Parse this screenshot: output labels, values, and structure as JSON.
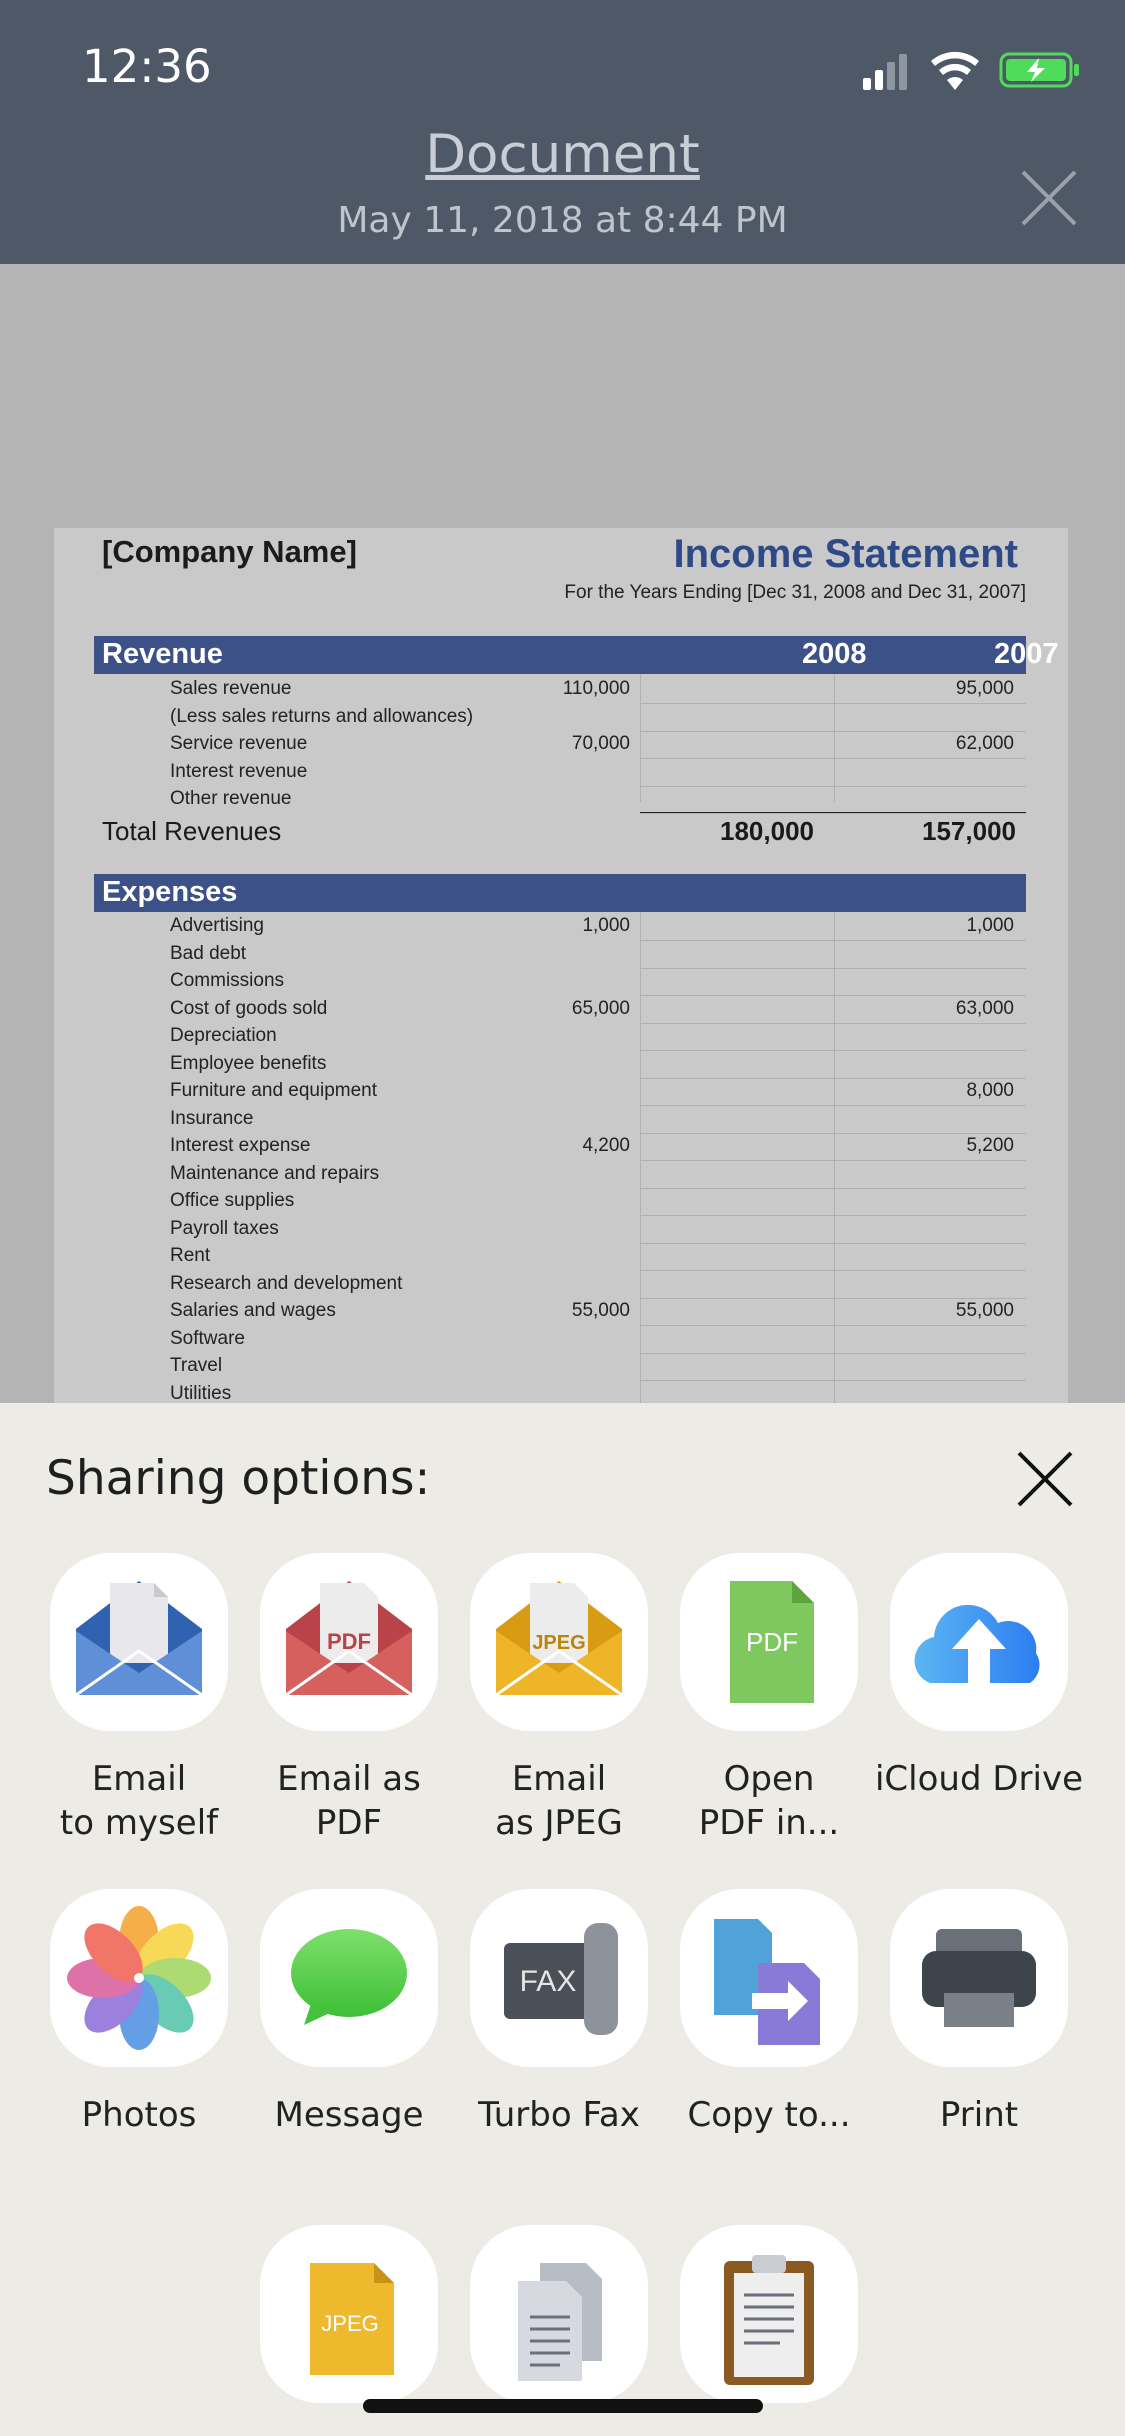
{
  "status": {
    "time": "12:36"
  },
  "header": {
    "title": "Document",
    "date": "May 11, 2018 at 8:44 PM"
  },
  "document": {
    "company": "[Company Name]",
    "heading": "Income Statement",
    "subtitle": "For the Years Ending [Dec 31, 2008 and Dec 31, 2007]",
    "revenue": {
      "title": "Revenue",
      "year1": "2008",
      "year2": "2007",
      "rows": [
        {
          "label": "Sales revenue",
          "v1": "110,000",
          "v2": "95,000"
        },
        {
          "label": "(Less sales returns and allowances)",
          "v1": "",
          "v2": ""
        },
        {
          "label": "Service revenue",
          "v1": "70,000",
          "v2": "62,000"
        },
        {
          "label": "Interest revenue",
          "v1": "",
          "v2": ""
        },
        {
          "label": "Other revenue",
          "v1": "",
          "v2": ""
        }
      ],
      "total_label": "Total Revenues",
      "total1": "180,000",
      "total2": "157,000"
    },
    "expenses": {
      "title": "Expenses",
      "rows": [
        {
          "label": "Advertising",
          "v1": "1,000",
          "v2": "1,000"
        },
        {
          "label": "Bad debt",
          "v1": "",
          "v2": ""
        },
        {
          "label": "Commissions",
          "v1": "",
          "v2": ""
        },
        {
          "label": "Cost of goods sold",
          "v1": "65,000",
          "v2": "63,000"
        },
        {
          "label": "Depreciation",
          "v1": "",
          "v2": ""
        },
        {
          "label": "Employee benefits",
          "v1": "",
          "v2": ""
        },
        {
          "label": "Furniture and equipment",
          "v1": "",
          "v2": "8,000"
        },
        {
          "label": "Insurance",
          "v1": "",
          "v2": ""
        },
        {
          "label": "Interest expense",
          "v1": "4,200",
          "v2": "5,200"
        },
        {
          "label": "Maintenance and repairs",
          "v1": "",
          "v2": ""
        },
        {
          "label": "Office supplies",
          "v1": "",
          "v2": ""
        },
        {
          "label": "Payroll taxes",
          "v1": "",
          "v2": ""
        },
        {
          "label": "Rent",
          "v1": "",
          "v2": ""
        },
        {
          "label": "Research and development",
          "v1": "",
          "v2": ""
        },
        {
          "label": "Salaries and wages",
          "v1": "55,000",
          "v2": "55,000"
        },
        {
          "label": "Software",
          "v1": "",
          "v2": ""
        },
        {
          "label": "Travel",
          "v1": "",
          "v2": ""
        },
        {
          "label": "Utilities",
          "v1": "",
          "v2": ""
        }
      ]
    }
  },
  "sharing": {
    "title": "Sharing options:",
    "options": [
      {
        "label": "Email\nto myself",
        "icon": "email-icon"
      },
      {
        "label": "Email as PDF",
        "icon": "email-pdf-icon",
        "badge": "PDF"
      },
      {
        "label": "Email\nas JPEG",
        "icon": "email-jpeg-icon",
        "badge": "JPEG"
      },
      {
        "label": "Open\nPDF in...",
        "icon": "pdf-file-icon",
        "badge": "PDF"
      },
      {
        "label": "iCloud Drive",
        "icon": "icloud-icon"
      },
      {
        "label": "Photos",
        "icon": "photos-icon"
      },
      {
        "label": "Message",
        "icon": "message-icon"
      },
      {
        "label": "Turbo Fax",
        "icon": "fax-icon",
        "badge": "FAX"
      },
      {
        "label": "Copy to...",
        "icon": "copy-to-icon"
      },
      {
        "label": "Print",
        "icon": "printer-icon"
      },
      {
        "label": "",
        "icon": "jpeg-file-icon",
        "badge": "JPEG"
      },
      {
        "label": "",
        "icon": "documents-icon"
      },
      {
        "label": "",
        "icon": "clipboard-icon"
      }
    ]
  }
}
